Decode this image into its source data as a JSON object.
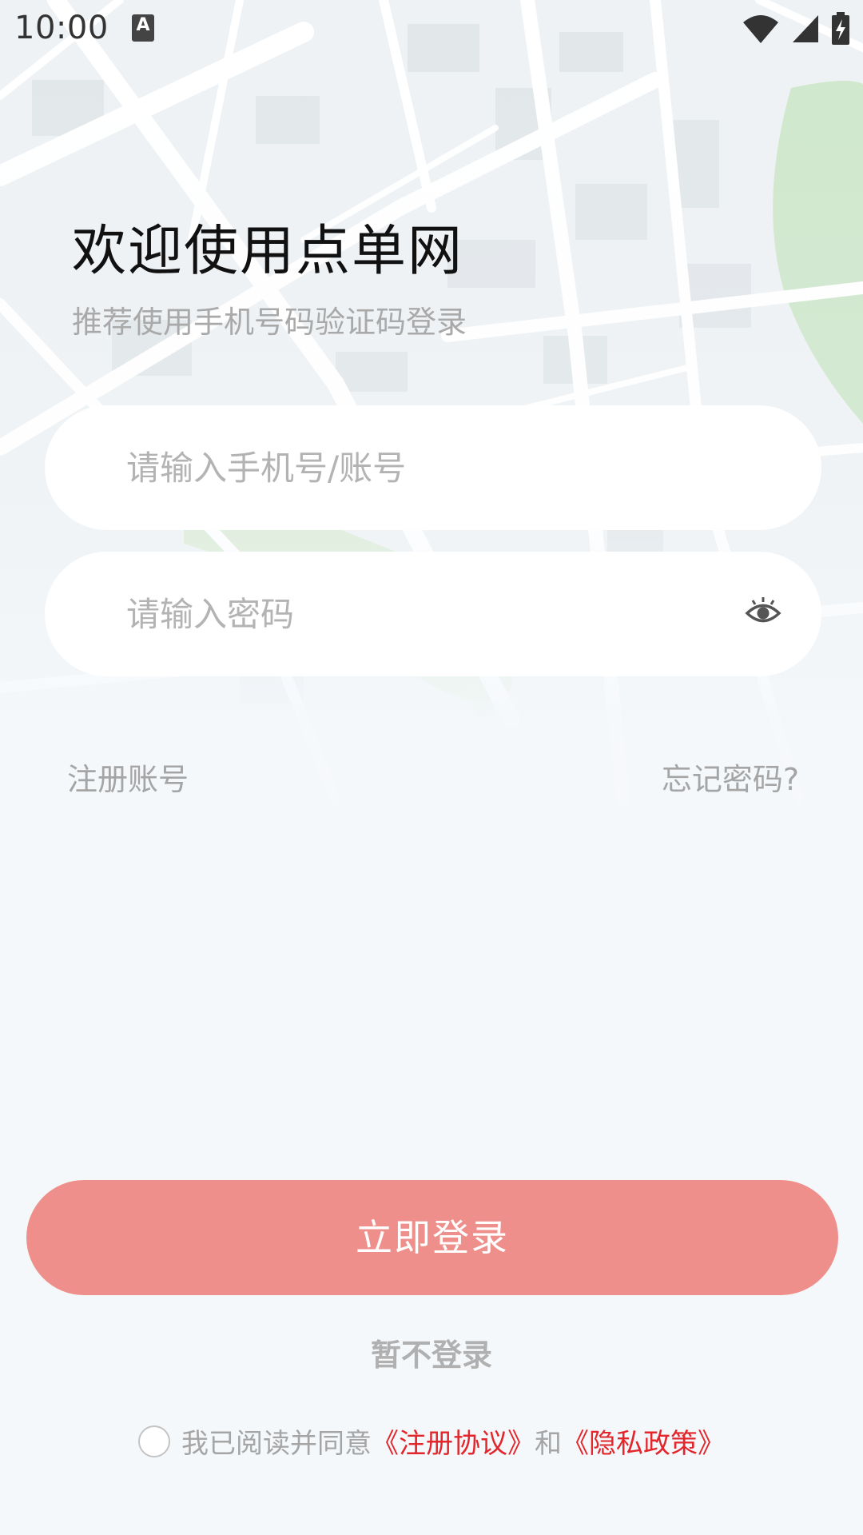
{
  "status_bar": {
    "time": "10:00",
    "notification_badge": "A"
  },
  "header": {
    "title": "欢迎使用点单网",
    "subtitle": "推荐使用手机号码验证码登录"
  },
  "form": {
    "account_placeholder": "请输入手机号/账号",
    "account_value": "",
    "password_placeholder": "请输入密码",
    "password_value": ""
  },
  "links": {
    "register": "注册账号",
    "forgot": "忘记密码?"
  },
  "actions": {
    "login_label": "立即登录",
    "skip_label": "暂不登录"
  },
  "agreement": {
    "prefix": "我已阅读并同意",
    "register_agreement": "《注册协议》",
    "conjunction": "和",
    "privacy_policy": "《隐私政策》",
    "checked": false
  },
  "colors": {
    "primary": "#ef8f8b",
    "link_red": "#e2262b",
    "placeholder": "#b3b3b3"
  },
  "icons": {
    "wifi": "wifi-icon",
    "signal": "signal-icon",
    "battery": "battery-charging-icon",
    "eye": "eye-icon"
  }
}
